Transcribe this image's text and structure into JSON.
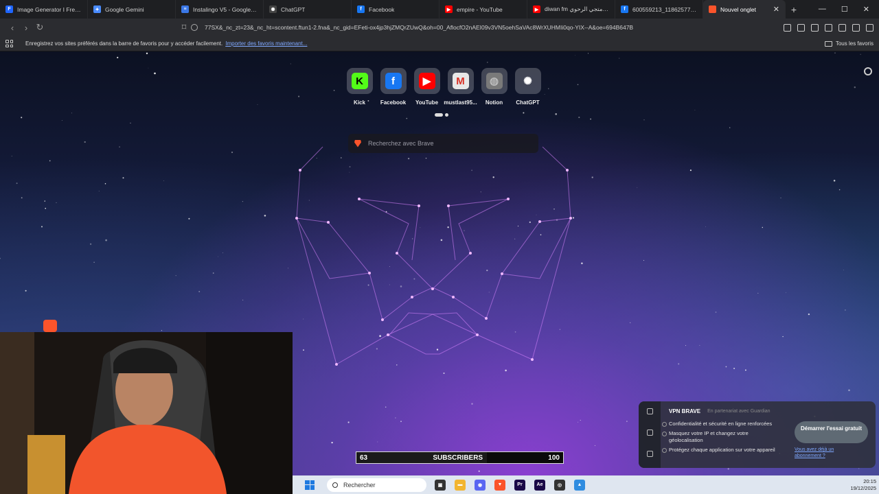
{
  "tabs": [
    {
      "label": "Image Generator I Freepik",
      "icon": "freepik-icon",
      "color": "#1f66ff",
      "glyph": "F"
    },
    {
      "label": "Google Gemini",
      "icon": "gemini-icon",
      "color": "#4a8cff",
      "glyph": "✦"
    },
    {
      "label": "Instalingo V5 - Google Do",
      "icon": "google-docs-icon",
      "color": "#3b78e7",
      "glyph": "≡"
    },
    {
      "label": "ChatGPT",
      "icon": "chatgpt-icon",
      "color": "#444444",
      "glyph": "✺"
    },
    {
      "label": "Facebook",
      "icon": "facebook-icon",
      "color": "#1877f2",
      "glyph": "f"
    },
    {
      "label": "empire - YouTube",
      "icon": "youtube-icon",
      "color": "#ff0000",
      "glyph": "▶"
    },
    {
      "label": "diwan fm متجي الرحوي - Y",
      "icon": "youtube-icon",
      "color": "#ff0000",
      "glyph": "▶"
    },
    {
      "label": "600559213_11862577670",
      "icon": "facebook-icon",
      "color": "#1877f2",
      "glyph": "f"
    }
  ],
  "active_tab": {
    "label": "Nouvel onglet",
    "icon": "brave-icon",
    "close": "✕"
  },
  "new_tab_glyph": "+",
  "window_controls": {
    "minimize": "—",
    "maximize": "☐",
    "close": "✕"
  },
  "address_bar": {
    "url": "77SX&_nc_zt=23&_nc_ht=scontent.ftun1-2.fna&_nc_gid=EFeti-ox4jp3hjZMQrZUwQ&oh=00_AflocfO2nAEI09v3VN5oehSaVAc8WrXUHMIi0qo-YIX--A&oe=694B647B"
  },
  "bookmarks_bar": {
    "message": "Enregistrez vos sites préférés dans la barre de favoris pour y accéder facilement.",
    "import_link": "Importer des favoris maintenant...",
    "all_favorites": "Tous les favoris"
  },
  "shortcuts": [
    {
      "label": "Kick",
      "icon": "kick-icon",
      "bg": "#53fc18",
      "fg": "#000000",
      "glyph": "K"
    },
    {
      "label": "Facebook",
      "icon": "facebook-icon",
      "bg": "#1877f2",
      "fg": "#ffffff",
      "glyph": "f"
    },
    {
      "label": "YouTube",
      "icon": "youtube-icon",
      "bg": "#ff0000",
      "fg": "#ffffff",
      "glyph": "▶"
    },
    {
      "label": "mustlast95...",
      "icon": "gmail-icon",
      "bg": "#e8e8e8",
      "fg": "#d93025",
      "glyph": "M"
    },
    {
      "label": "Notion",
      "icon": "globe-icon",
      "bg": "#7a7a7a",
      "fg": "#bbbbbb",
      "glyph": "◍"
    },
    {
      "label": "ChatGPT",
      "icon": "chatgpt-icon",
      "bg": "#ffffff00",
      "fg": "#ffffff",
      "glyph": "✺"
    }
  ],
  "search": {
    "placeholder": "Recherchez avec Brave"
  },
  "subscribers": {
    "current": "63",
    "label": "SUBSCRIBERS",
    "goal": "100",
    "progress": 0.63
  },
  "vpn": {
    "title": "VPN BRAVE",
    "partner": "En partenariat avec Guardian",
    "features": [
      "Confidentialité et sécurité en ligne renforcées",
      "Masquez votre IP et changez votre géolocalisation",
      "Protégez chaque application sur votre appareil"
    ],
    "cta": "Démarrer l'essai gratuit",
    "login": "Vous avez déjà un abonnement ?"
  },
  "taskbar": {
    "search_placeholder": "Rechercher",
    "apps": [
      {
        "icon": "file-explorer-icon",
        "color": "#333333",
        "glyph": "▣"
      },
      {
        "icon": "folder-icon",
        "color": "#f2b530",
        "glyph": "▬"
      },
      {
        "icon": "discord-icon",
        "color": "#5865f2",
        "glyph": "◉"
      },
      {
        "icon": "brave-icon",
        "color": "#fb542b",
        "glyph": "▼"
      },
      {
        "icon": "premiere-pro-icon",
        "color": "#1a0a48",
        "glyph": "Pr"
      },
      {
        "icon": "after-effects-icon",
        "color": "#1a0a48",
        "glyph": "Ae"
      },
      {
        "icon": "davinci-resolve-icon",
        "color": "#333333",
        "glyph": "◎"
      },
      {
        "icon": "photos-icon",
        "color": "#2f8ce0",
        "glyph": "▲"
      }
    ],
    "time": "20:15",
    "date": "19/12/2025"
  }
}
